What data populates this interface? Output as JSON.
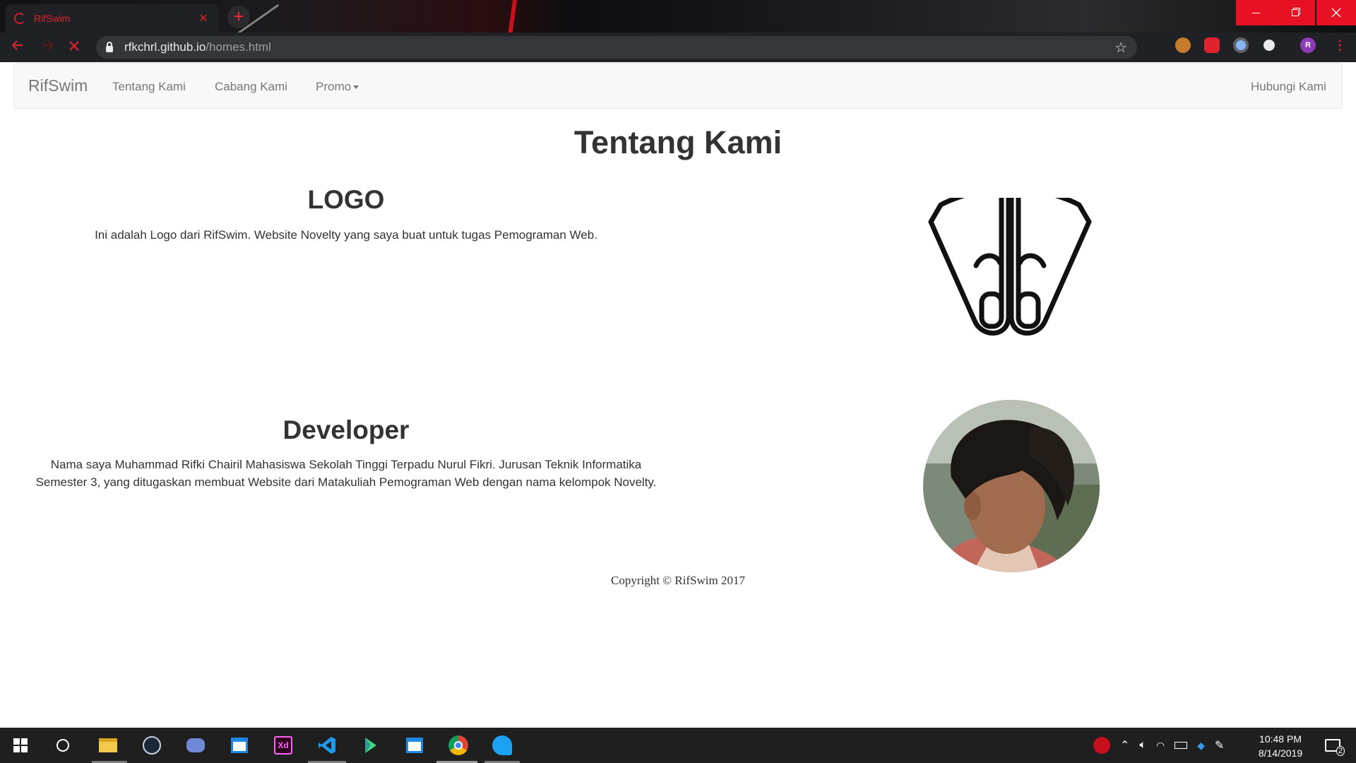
{
  "browser": {
    "tab_title": "RifSwim",
    "tab_close": "✕",
    "new_tab": "+",
    "url_host": "rfkchrl.github.io",
    "url_path": "/homes.html",
    "profile_initial": "R"
  },
  "navbar": {
    "brand": "RifSwim",
    "items": [
      {
        "label": "Tentang Kami"
      },
      {
        "label": "Cabang Kami"
      },
      {
        "label": "Promo"
      }
    ],
    "right_item": "Hubungi Kami"
  },
  "content": {
    "page_title": "Tentang Kami",
    "logo_section": {
      "heading": "LOGO",
      "text": "Ini adalah Logo dari RifSwim. Website Novelty yang saya buat untuk tugas Pemograman Web."
    },
    "developer_section": {
      "heading": "Developer",
      "text": "Nama saya Muhammad Rifki Chairil Mahasiswa Sekolah Tinggi Terpadu Nurul Fikri. Jurusan Teknik Informatika Semester 3, yang ditugaskan membuat Website dari Matakuliah Pemograman Web dengan nama kelompok Novelty."
    },
    "copyright": "Copyright © RifSwim 2017"
  },
  "taskbar": {
    "time": "10:48 PM",
    "date": "8/14/2019",
    "notification_count": "2",
    "apps": [
      "windows-start",
      "cortana",
      "file-explorer",
      "steam",
      "discord",
      "app-window",
      "adobe-xd",
      "vscode",
      "android-studio",
      "app-window-2",
      "chrome",
      "app-bird"
    ]
  },
  "colors": {
    "accent_red": "#e0232f",
    "navbar_bg": "#f8f8f8",
    "navbar_text": "#777777",
    "body_text": "#333333"
  }
}
